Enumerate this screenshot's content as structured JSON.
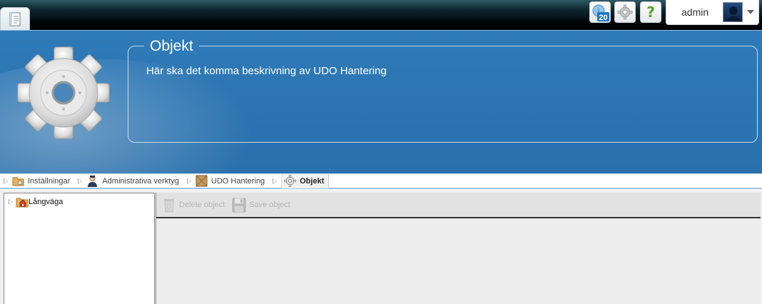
{
  "topbar": {
    "notification_count": "20",
    "help_glyph": "?",
    "user_name": "admin"
  },
  "header": {
    "title": "Objekt",
    "description": "Här ska det komma beskrivning av UDO Hantering",
    "colors": {
      "background": "#2f7ab8",
      "text": "#ffffff"
    }
  },
  "breadcrumb": [
    {
      "label": "Inställningar",
      "icon": "settings-folder-icon"
    },
    {
      "label": "Administrativa verktyg",
      "icon": "admin-person-icon"
    },
    {
      "label": "UDO Hantering",
      "icon": "box-icon"
    },
    {
      "label": "Objekt",
      "icon": "gear-icon"
    }
  ],
  "tree": {
    "items": [
      {
        "label": "Långväga",
        "icon": "folder-house-icon"
      }
    ]
  },
  "toolbar": {
    "delete_label": "Delete object",
    "save_label": "Save object"
  }
}
